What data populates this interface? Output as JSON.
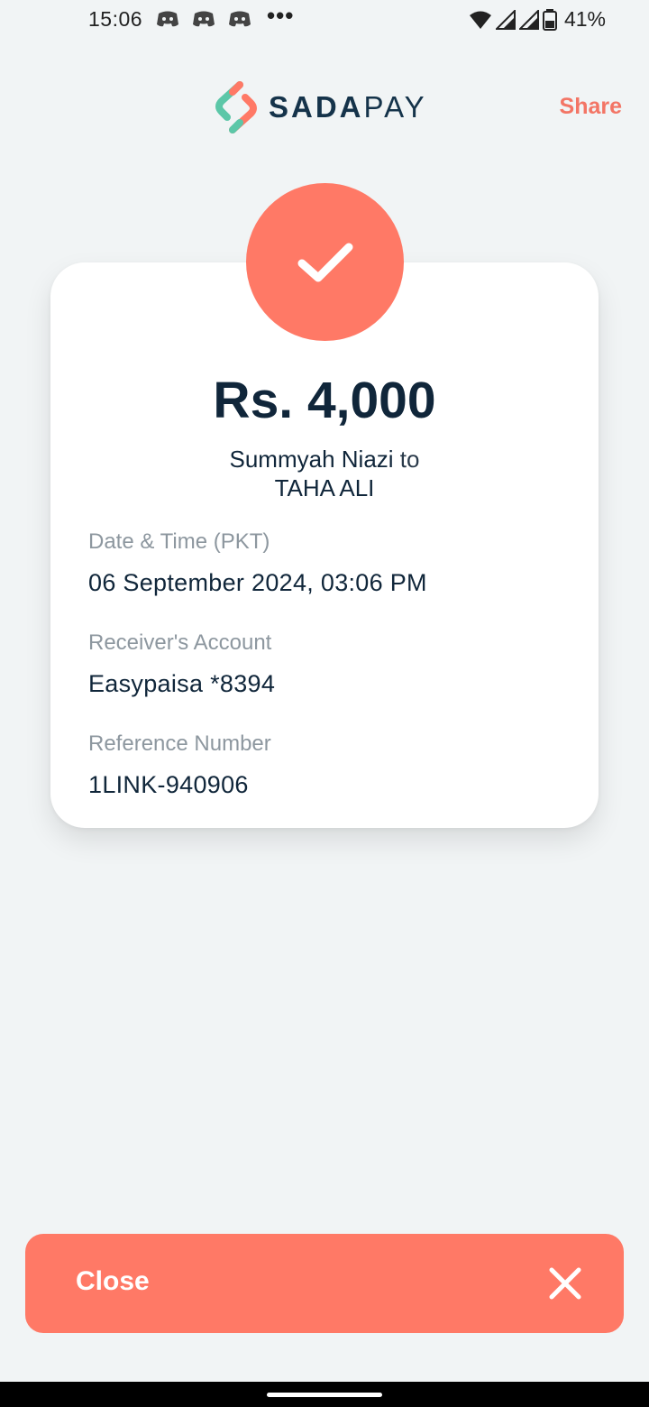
{
  "status_bar": {
    "time": "15:06",
    "notification_icons": [
      "discord-icon",
      "discord-icon",
      "discord-icon"
    ],
    "more": "•••",
    "icons": [
      "wifi-icon",
      "signal-icon",
      "signal-icon",
      "battery-icon"
    ],
    "battery": "41%"
  },
  "header": {
    "logo_text_bold": "SADA",
    "logo_text_regular": "PAY",
    "share_label": "Share"
  },
  "receipt": {
    "status_icon": "checkmark-icon",
    "amount": "Rs. 4,000",
    "sender": "Summyah Niazi",
    "connector": "to",
    "receiver": "TAHA ALI",
    "details": [
      {
        "label": "Date & Time (PKT)",
        "value": "06 September 2024, 03:06 PM"
      },
      {
        "label": "Receiver's Account",
        "value": "Easypaisa *8394"
      },
      {
        "label": "Reference Number",
        "value": "1LINK-940906"
      }
    ]
  },
  "footer": {
    "close_label": "Close",
    "close_icon": "close-icon"
  },
  "colors": {
    "accent": "#ff7966",
    "share": "#f37565",
    "text_dark": "#10263a",
    "label_gray": "#8d979f",
    "background": "#f1f4f5",
    "logo_teal": "#5cc7a8",
    "logo_coral": "#ff7966"
  }
}
